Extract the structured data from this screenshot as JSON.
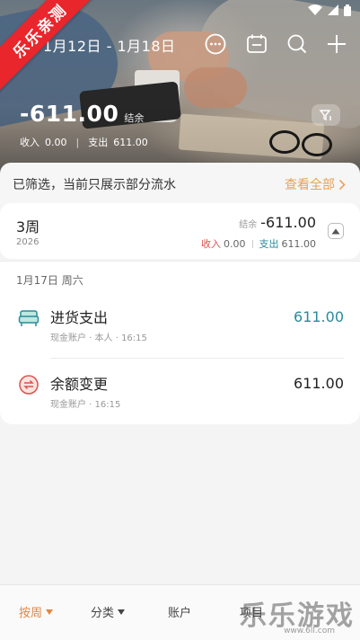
{
  "ribbon": "乐乐亲测",
  "header": {
    "date_range": "1月12日 - 1月18日",
    "balance_amount": "-611.00",
    "balance_label": "结余",
    "income_label": "收入",
    "income_value": "0.00",
    "expense_label": "支出",
    "expense_value": "611.00",
    "icons": [
      "more-icon",
      "calendar-icon",
      "search-icon",
      "add-icon",
      "filter-icon"
    ]
  },
  "notice": {
    "text": "已筛选，当前只展示部分流水",
    "link": "查看全部"
  },
  "week": {
    "title": "3周",
    "year": "2026",
    "balance_label": "结余",
    "balance_value": "-611.00",
    "income_label": "收入",
    "income_value": "0.00",
    "expense_label": "支出",
    "expense_value": "611.00"
  },
  "day": {
    "header": "1月17日  周六",
    "transactions": [
      {
        "title": "进货支出",
        "meta": "现金账户 · 本人 · 16:15",
        "amount": "611.00",
        "icon": "sofa-icon",
        "kind": "expense"
      },
      {
        "title": "余额变更",
        "meta": "现金账户 · 16:15",
        "amount": "611.00",
        "icon": "balance-change-icon",
        "kind": "neutral"
      }
    ]
  },
  "nav": {
    "items": [
      "按周",
      "分类",
      "账户",
      "项目"
    ]
  },
  "watermark": {
    "text": "乐乐游戏",
    "url": "www.6ll.com"
  },
  "colors": {
    "accent": "#e8853c",
    "link": "#e8a058",
    "income": "#d9534f",
    "expense": "#2a8a9a",
    "ribbon": "#e8262c"
  }
}
